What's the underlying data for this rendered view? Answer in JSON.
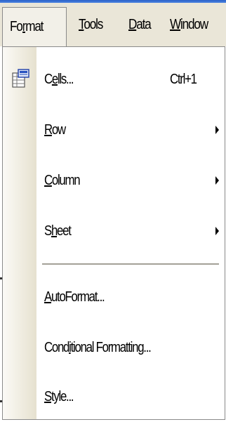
{
  "menubar": {
    "items": [
      {
        "label": "Format",
        "underline_index": 2
      },
      {
        "label": "Tools",
        "underline_index": 0
      },
      {
        "label": "Data",
        "underline_index": 0
      },
      {
        "label": "Window",
        "underline_index": 0
      }
    ]
  },
  "format_menu": {
    "items": [
      {
        "label": "Cells...",
        "underline_index": 1,
        "shortcut": "Ctrl+1",
        "icon": "format-cells-icon"
      },
      {
        "label": "Row",
        "underline_index": 0,
        "submenu": true
      },
      {
        "label": "Column",
        "underline_index": 0,
        "submenu": true
      },
      {
        "label": "Sheet",
        "underline_index": 1,
        "submenu": true
      },
      {
        "label": "AutoFormat...",
        "underline_index": 0
      },
      {
        "label": "Conditional Formatting...",
        "underline_index": 4
      },
      {
        "label": "Style...",
        "underline_index": 0
      }
    ]
  },
  "colors": {
    "menubar_background": "#eae6d8",
    "title_strip": "#2b62c8",
    "menu_background": "#ffffff",
    "gutter": "#e6e1cf"
  }
}
